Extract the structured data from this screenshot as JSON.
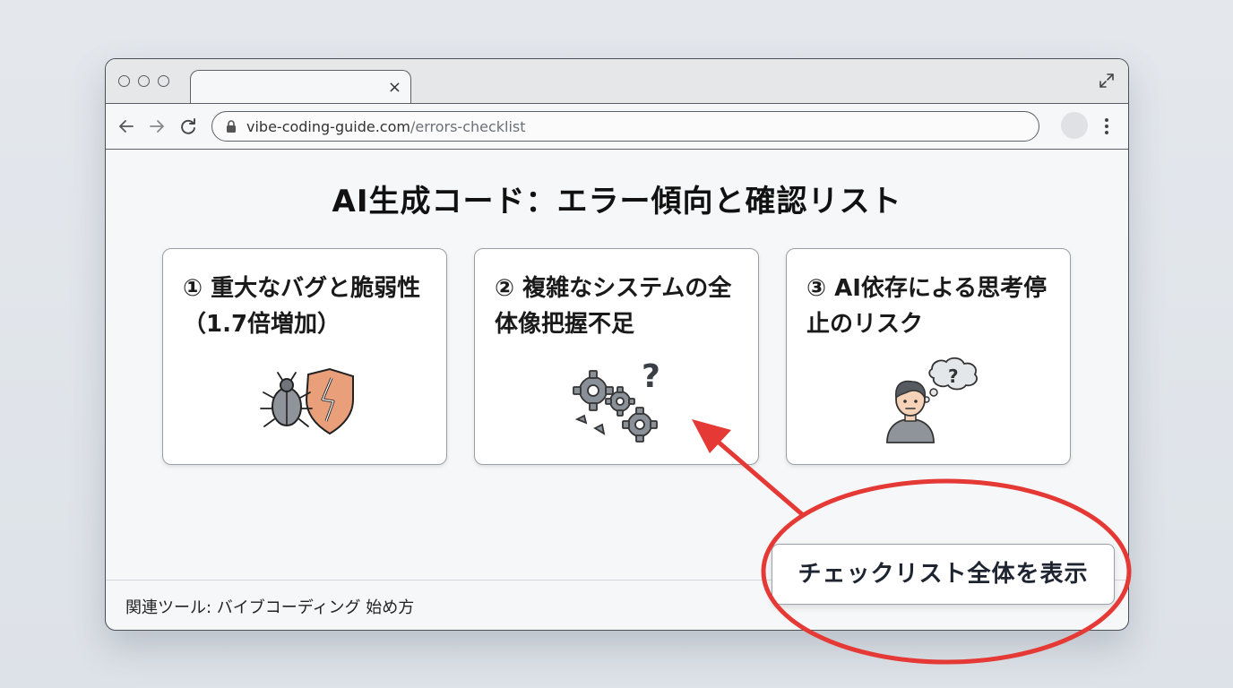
{
  "browser": {
    "url_domain": "vibe-coding-guide.com",
    "url_path": "/errors-checklist",
    "tab_close": "×"
  },
  "page": {
    "title": "AI生成コード：エラー傾向と確認リスト",
    "cards": [
      {
        "title": "① 重大なバグと脆弱性（1.7倍増加）",
        "icon": "bug-shield-icon"
      },
      {
        "title": "② 複雑なシステムの全体像把握不足",
        "icon": "gears-question-icon"
      },
      {
        "title": "③ AI依存による思考停止のリスク",
        "icon": "thinking-person-icon"
      }
    ],
    "cta_label": "チェックリスト全体を表示",
    "footer": "関連ツール: バイブコーディング  始め方"
  },
  "colors": {
    "annotation_red": "#e53935",
    "shield_orange": "#e9a07a",
    "gear_gray": "#8a9097"
  }
}
